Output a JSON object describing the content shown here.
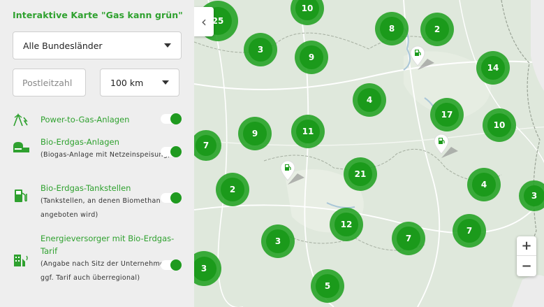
{
  "sidebar": {
    "title": "Interaktive Karte \"Gas kann grün\"",
    "state_select": "Alle Bundesländer",
    "postcode_placeholder": "Postleitzahl",
    "radius_select": "100 km",
    "layers": [
      {
        "icon": "power-to-gas-icon",
        "label": "Power-to-Gas-Anlagen",
        "desc": "",
        "enabled": true
      },
      {
        "icon": "biogas-plant-icon",
        "label": "Bio-Erdgas-Anlagen",
        "desc": "(Biogas-Anlage mit Netzeinspeisung)",
        "enabled": true
      },
      {
        "icon": "fuel-pump-icon",
        "label": "Bio-Erdgas-Tankstellen",
        "desc": "(Tankstellen, an denen Biomethan angeboten wird)",
        "enabled": true
      },
      {
        "icon": "energy-supplier-icon",
        "label": "Energieversorger mit Bio-Erdgas-Tarif",
        "desc": "(Angabe nach Sitz der Unternehmen, ggf. Tarif auch überregional)",
        "enabled": true
      }
    ]
  },
  "map": {
    "collapse_glyph": "‹",
    "zoom_in": "+",
    "zoom_out": "−",
    "colors": {
      "cluster": "#1b9a1b",
      "land": "#dfe8dc",
      "water": "#a9c6d8"
    },
    "clusters": [
      {
        "id": "c1",
        "count": "25"
      },
      {
        "id": "c2",
        "count": "10"
      },
      {
        "id": "c3",
        "count": "8"
      },
      {
        "id": "c4",
        "count": "2"
      },
      {
        "id": "c5",
        "count": "3"
      },
      {
        "id": "c6",
        "count": "9"
      },
      {
        "id": "c7",
        "count": "14"
      },
      {
        "id": "c8",
        "count": "4"
      },
      {
        "id": "c9",
        "count": "17"
      },
      {
        "id": "c10",
        "count": "10"
      },
      {
        "id": "c11",
        "count": "7"
      },
      {
        "id": "c12",
        "count": "9"
      },
      {
        "id": "c13",
        "count": "11"
      },
      {
        "id": "c14",
        "count": "21"
      },
      {
        "id": "c15",
        "count": "2"
      },
      {
        "id": "c16",
        "count": "4"
      },
      {
        "id": "c17",
        "count": "3"
      },
      {
        "id": "c18",
        "count": "12"
      },
      {
        "id": "c19",
        "count": "7"
      },
      {
        "id": "c20",
        "count": "7"
      },
      {
        "id": "c21",
        "count": "3"
      },
      {
        "id": "c22",
        "count": "3"
      },
      {
        "id": "c23",
        "count": "5"
      }
    ]
  }
}
